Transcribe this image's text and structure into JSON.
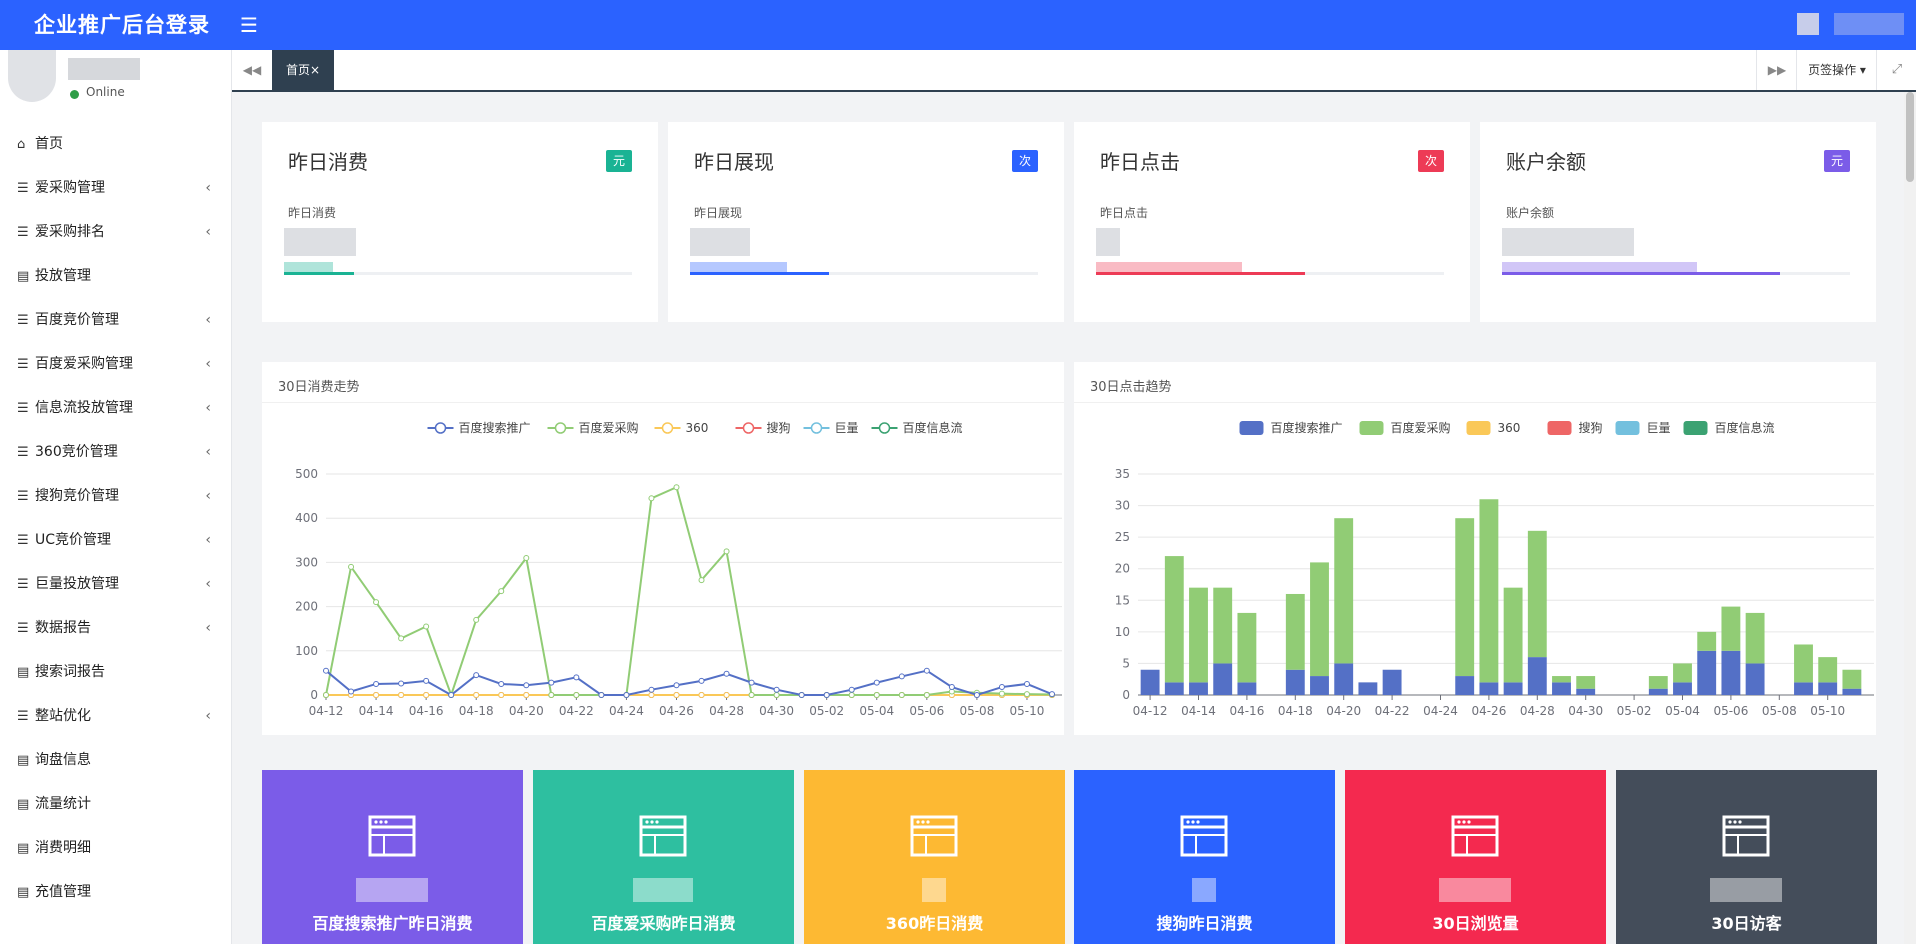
{
  "header": {
    "brand": "企业推广后台登录",
    "menu_toggle_icon": "hamburger-icon"
  },
  "sidebar": {
    "status": "Online",
    "items": [
      {
        "label": "首页",
        "icon": "home-icon",
        "has_children": false
      },
      {
        "label": "爱采购管理",
        "icon": "list-icon",
        "has_children": true
      },
      {
        "label": "爱采购排名",
        "icon": "list-icon",
        "has_children": true
      },
      {
        "label": "投放管理",
        "icon": "document-icon",
        "has_children": false
      },
      {
        "label": "百度竞价管理",
        "icon": "list-icon",
        "has_children": true
      },
      {
        "label": "百度爱采购管理",
        "icon": "list-icon",
        "has_children": true
      },
      {
        "label": "信息流投放管理",
        "icon": "list-icon",
        "has_children": true
      },
      {
        "label": "360竞价管理",
        "icon": "list-icon",
        "has_children": true
      },
      {
        "label": "搜狗竞价管理",
        "icon": "list-icon",
        "has_children": true
      },
      {
        "label": "UC竞价管理",
        "icon": "list-icon",
        "has_children": true
      },
      {
        "label": "巨量投放管理",
        "icon": "list-icon",
        "has_children": true
      },
      {
        "label": "数据报告",
        "icon": "list-icon",
        "has_children": true
      },
      {
        "label": "搜索词报告",
        "icon": "document-icon",
        "has_children": false
      },
      {
        "label": "整站优化",
        "icon": "list-icon",
        "has_children": true
      },
      {
        "label": "询盘信息",
        "icon": "document-icon",
        "has_children": false
      },
      {
        "label": "流量统计",
        "icon": "document-icon",
        "has_children": false
      },
      {
        "label": "消费明细",
        "icon": "document-icon",
        "has_children": false
      },
      {
        "label": "充值管理",
        "icon": "document-icon",
        "has_children": false
      }
    ]
  },
  "tabs": {
    "home_label": "首页",
    "close_glyph": "×",
    "ops_label": "页签操作"
  },
  "stats": [
    {
      "title": "昨日消费",
      "badge": "元",
      "sub": "昨日消费",
      "color": "#1ab394",
      "progress": 0.2
    },
    {
      "title": "昨日展现",
      "badge": "次",
      "sub": "昨日展现",
      "color": "#2b62ff",
      "progress": 0.4
    },
    {
      "title": "昨日点击",
      "badge": "次",
      "sub": "昨日点击",
      "color": "#ed3b56",
      "progress": 0.6
    },
    {
      "title": "账户余额",
      "badge": "元",
      "sub": "账户余额",
      "color": "#7b5ce8",
      "progress": 0.8
    }
  ],
  "chart_data": [
    {
      "type": "line",
      "title": "30日消费走势",
      "xlabel": "",
      "ylabel": "",
      "ylim": [
        0,
        500
      ],
      "yticks": [
        0,
        100,
        200,
        300,
        400,
        500
      ],
      "x": [
        "04-12",
        "04-13",
        "04-14",
        "04-15",
        "04-16",
        "04-17",
        "04-18",
        "04-19",
        "04-20",
        "04-21",
        "04-22",
        "04-23",
        "04-24",
        "04-25",
        "04-26",
        "04-27",
        "04-28",
        "04-29",
        "04-30",
        "05-01",
        "05-02",
        "05-03",
        "05-04",
        "05-05",
        "05-06",
        "05-07",
        "05-08",
        "05-09",
        "05-10",
        "05-11"
      ],
      "xtick_labels": [
        "04-12",
        "04-14",
        "04-16",
        "04-18",
        "04-20",
        "04-22",
        "04-24",
        "04-26",
        "04-28",
        "04-30",
        "05-02",
        "05-04",
        "05-06",
        "05-08",
        "05-10"
      ],
      "legend_position": "top",
      "series": [
        {
          "name": "百度搜索推广",
          "color": "#5470c6",
          "values": [
            55,
            8,
            25,
            26,
            32,
            0,
            45,
            25,
            22,
            28,
            40,
            0,
            0,
            12,
            22,
            32,
            48,
            28,
            12,
            0,
            0,
            12,
            28,
            42,
            55,
            18,
            0,
            18,
            25,
            2
          ]
        },
        {
          "name": "百度爱采购",
          "color": "#91cc75",
          "values": [
            0,
            290,
            210,
            128,
            155,
            0,
            170,
            235,
            310,
            0,
            0,
            0,
            0,
            445,
            470,
            260,
            325,
            0,
            0,
            0,
            0,
            0,
            0,
            0,
            0,
            8,
            5,
            3,
            2,
            1
          ]
        },
        {
          "name": "360",
          "color": "#fac858",
          "values": [
            0,
            0,
            0,
            0,
            0,
            0,
            0,
            0,
            0,
            0,
            0,
            0,
            0,
            0,
            0,
            0,
            0,
            0,
            0,
            0,
            0,
            0,
            0,
            0,
            0,
            0,
            0,
            0,
            0,
            0
          ]
        },
        {
          "name": "搜狗",
          "color": "#ee6666",
          "values": [
            0,
            0,
            0,
            0,
            0,
            0,
            0,
            0,
            0,
            0,
            0,
            0,
            0,
            0,
            0,
            0,
            0,
            0,
            0,
            0,
            0,
            0,
            0,
            0,
            0,
            0,
            0,
            0,
            0,
            0
          ]
        },
        {
          "name": "巨量",
          "color": "#73c0de",
          "values": [
            0,
            0,
            0,
            0,
            0,
            0,
            0,
            0,
            0,
            0,
            0,
            0,
            0,
            0,
            0,
            0,
            0,
            0,
            0,
            0,
            0,
            0,
            0,
            0,
            0,
            0,
            0,
            0,
            0,
            0
          ]
        },
        {
          "name": "百度信息流",
          "color": "#3ba272",
          "values": [
            0,
            0,
            0,
            0,
            0,
            0,
            0,
            0,
            0,
            0,
            0,
            0,
            0,
            0,
            0,
            0,
            0,
            0,
            0,
            0,
            0,
            0,
            0,
            0,
            0,
            0,
            0,
            0,
            0,
            0
          ]
        }
      ]
    },
    {
      "type": "bar",
      "stacked": true,
      "title": "30日点击趋势",
      "xlabel": "",
      "ylabel": "",
      "ylim": [
        0,
        35
      ],
      "yticks": [
        0,
        5,
        10,
        15,
        20,
        25,
        30,
        35
      ],
      "x": [
        "04-12",
        "04-13",
        "04-14",
        "04-15",
        "04-16",
        "04-17",
        "04-18",
        "04-19",
        "04-20",
        "04-21",
        "04-22",
        "04-23",
        "04-24",
        "04-25",
        "04-26",
        "04-27",
        "04-28",
        "04-29",
        "04-30",
        "05-01",
        "05-02",
        "05-03",
        "05-04",
        "05-05",
        "05-06",
        "05-07",
        "05-08",
        "05-09",
        "05-10",
        "05-11"
      ],
      "xtick_labels": [
        "04-12",
        "04-14",
        "04-16",
        "04-18",
        "04-20",
        "04-22",
        "04-24",
        "04-26",
        "04-28",
        "04-30",
        "05-02",
        "05-04",
        "05-06",
        "05-08",
        "05-10"
      ],
      "legend_position": "top",
      "series": [
        {
          "name": "百度搜索推广",
          "color": "#5470c6",
          "values": [
            4,
            2,
            2,
            5,
            2,
            0,
            4,
            3,
            5,
            2,
            4,
            0,
            0,
            3,
            2,
            2,
            6,
            2,
            1,
            0,
            0,
            1,
            2,
            7,
            7,
            5,
            0,
            2,
            2,
            1
          ]
        },
        {
          "name": "百度爱采购",
          "color": "#91cc75",
          "values": [
            0,
            20,
            15,
            12,
            11,
            0,
            12,
            18,
            23,
            0,
            0,
            0,
            0,
            25,
            29,
            15,
            20,
            1,
            2,
            0,
            0,
            2,
            3,
            3,
            7,
            8,
            0,
            6,
            4,
            3
          ]
        },
        {
          "name": "360",
          "color": "#fac858",
          "values": [
            0,
            0,
            0,
            0,
            0,
            0,
            0,
            0,
            0,
            0,
            0,
            0,
            0,
            0,
            0,
            0,
            0,
            0,
            0,
            0,
            0,
            0,
            0,
            0,
            0,
            0,
            0,
            0,
            0,
            0
          ]
        },
        {
          "name": "搜狗",
          "color": "#ee6666",
          "values": [
            0,
            0,
            0,
            0,
            0,
            0,
            0,
            0,
            0,
            0,
            0,
            0,
            0,
            0,
            0,
            0,
            0,
            0,
            0,
            0,
            0,
            0,
            0,
            0,
            0,
            0,
            0,
            0,
            0,
            0
          ]
        },
        {
          "name": "巨量",
          "color": "#73c0de",
          "values": [
            0,
            0,
            0,
            0,
            0,
            0,
            0,
            0,
            0,
            0,
            0,
            0,
            0,
            0,
            0,
            0,
            0,
            0,
            0,
            0,
            0,
            0,
            0,
            0,
            0,
            0,
            0,
            0,
            0,
            0
          ]
        },
        {
          "name": "百度信息流",
          "color": "#3ba272",
          "values": [
            0,
            0,
            0,
            0,
            0,
            0,
            0,
            0,
            0,
            0,
            0,
            0,
            0,
            0,
            0,
            0,
            0,
            0,
            0,
            0,
            0,
            0,
            0,
            0,
            0,
            0,
            0,
            0,
            0,
            0
          ]
        }
      ]
    }
  ],
  "tiles": [
    {
      "label": "百度搜索推广昨日消费",
      "color": "#7b5ce8",
      "icon": "browser-window-icon"
    },
    {
      "label": "百度爱采购昨日消费",
      "color": "#2ebfa0",
      "icon": "browser-window-icon"
    },
    {
      "label": "360昨日消费",
      "color": "#fdb933",
      "icon": "browser-window-icon"
    },
    {
      "label": "搜狗昨日消费",
      "color": "#2b62ff",
      "icon": "browser-window-icon"
    },
    {
      "label": "30日浏览量",
      "color": "#f4294f",
      "icon": "browser-window-icon"
    },
    {
      "label": "30日访客",
      "color": "#444d5a",
      "icon": "browser-window-icon"
    }
  ]
}
